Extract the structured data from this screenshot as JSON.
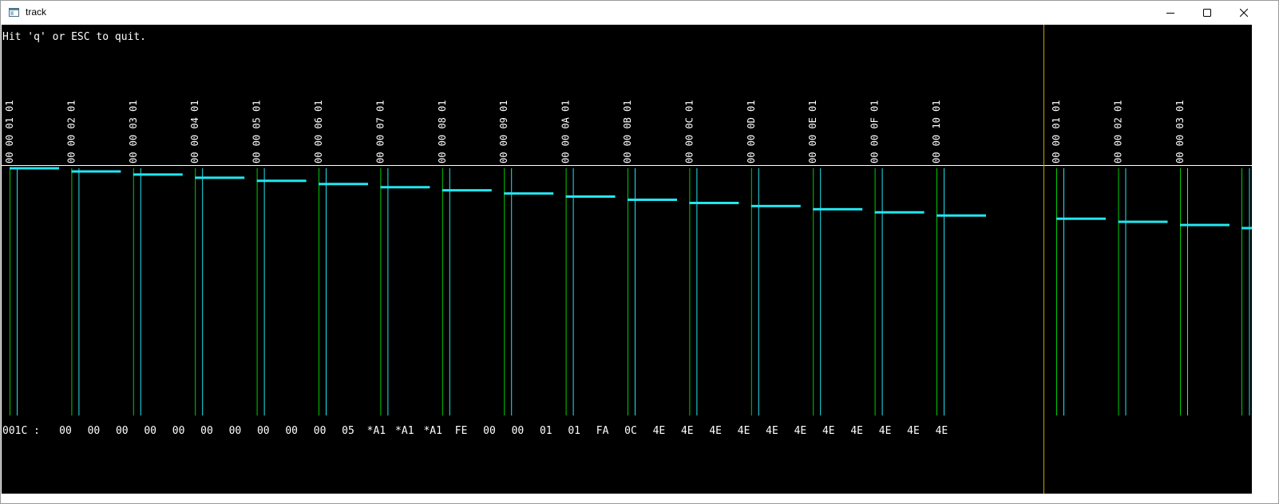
{
  "window": {
    "title": "track",
    "app_icon": "window-app-icon",
    "controls": [
      {
        "name": "minimize",
        "icon": "minimize-icon"
      },
      {
        "name": "maximize",
        "icon": "maximize-icon"
      },
      {
        "name": "close",
        "icon": "close-icon"
      }
    ]
  },
  "help_text": "Hit 'q' or ESC to quit.",
  "sector_headers": [
    "00 00 01 01",
    "00 00 02 01",
    "00 00 03 01",
    "00 00 04 01",
    "00 00 05 01",
    "00 00 06 01",
    "00 00 07 01",
    "00 00 08 01",
    "00 00 09 01",
    "00 00 0A 01",
    "00 00 0B 01",
    "00 00 0C 01",
    "00 00 0D 01",
    "00 00 0E 01",
    "00 00 0F 01",
    "00 00 10 01",
    "00 00 01 01",
    "00 00 02 01",
    "00 00 03 01"
  ],
  "data_row": {
    "offset": "001C :",
    "bytes": [
      "00",
      "00",
      "00",
      "00",
      "00",
      "00",
      "00",
      "00",
      "00",
      "00",
      "05",
      "*A1",
      "*A1",
      "*A1",
      "FE",
      "00",
      "00",
      "01",
      "01",
      "FA",
      "0C",
      "4E",
      "4E",
      "4E",
      "4E",
      "4E",
      "4E",
      "4E",
      "4E",
      "4E",
      "4E",
      "4E"
    ]
  },
  "colors": {
    "background": "#000000",
    "text": "#ffffff",
    "green_marker": "#00cc00",
    "cyan_marker": "#22e6f0",
    "index_line": "#c8a000",
    "baseline": "#ffffff"
  }
}
